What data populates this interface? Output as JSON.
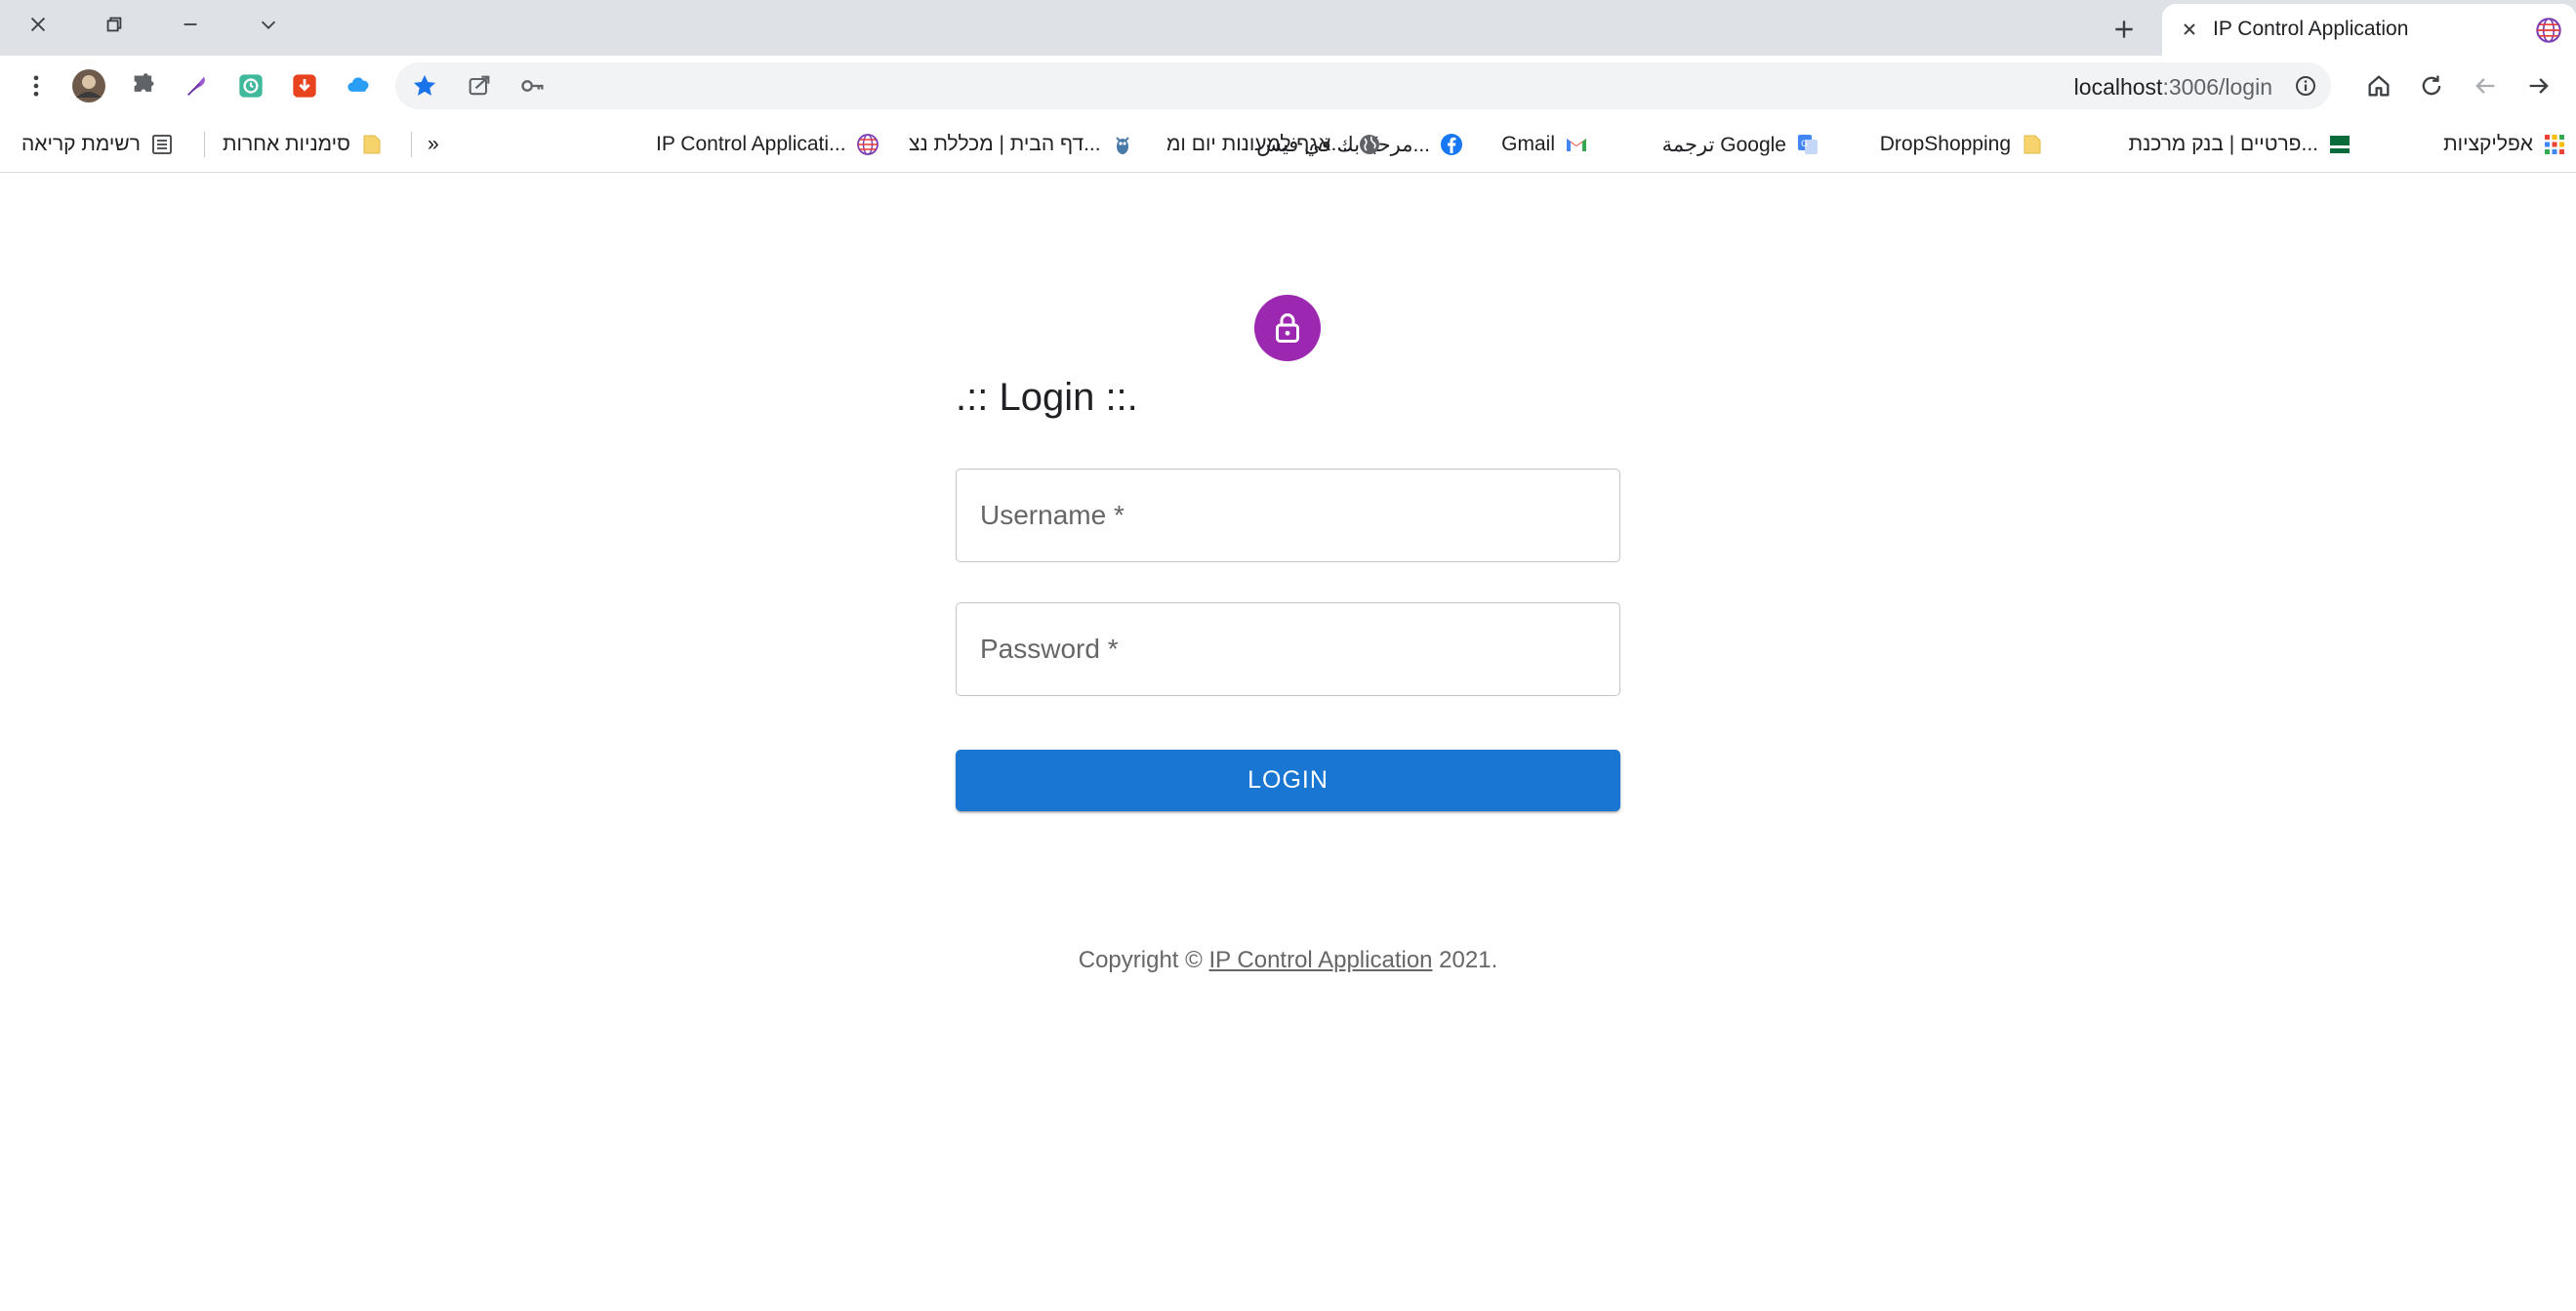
{
  "browser": {
    "tab_title": "IP Control Application",
    "url_host": "localhost",
    "url_path": ":3006/login",
    "new_tab_label": "+"
  },
  "bookmarks": {
    "apps": "אפליקציות",
    "items": [
      "פרטיים | בנק מרכנת...",
      "DropShopping",
      "ترجمة Google",
      "Gmail",
      "مرحبًا بك في فيس...",
      "אגף למעונות יום ומ...",
      "דף הבית | מכללת נצ...",
      "IP Control Applicati..."
    ],
    "overflow": "»",
    "other_bookmarks": "סימניות אחרות",
    "reading_list": "רשימת קריאה"
  },
  "login": {
    "title": ".:: Login ::.",
    "username_placeholder": "Username *",
    "password_placeholder": "Password *",
    "button_label": "LOGIN",
    "avatar_color": "#9c27b0",
    "button_color": "#1976d2"
  },
  "footer": {
    "prefix": "Copyright © ",
    "link_text": "IP Control Application",
    "suffix": " 2021."
  },
  "icons": {
    "close": "close-icon",
    "lock": "lock-icon",
    "star": "star-icon",
    "key": "key-icon",
    "puzzle": "extensions-icon"
  }
}
